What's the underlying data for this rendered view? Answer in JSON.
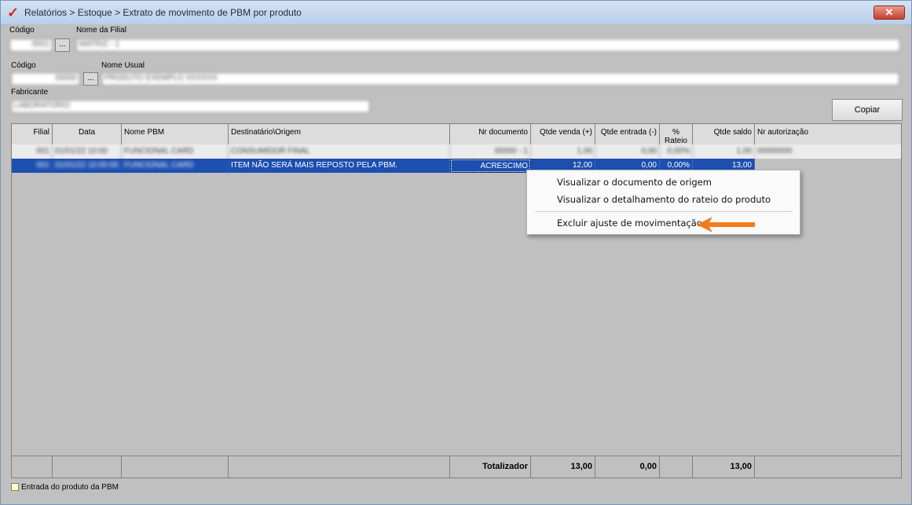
{
  "window": {
    "title": "Relatórios > Estoque > Extrato de movimento de PBM por produto",
    "close_glyph": "✕",
    "icon": "check-logo-icon"
  },
  "filial": {
    "codigo_label": "Código",
    "codigo_value": "0001",
    "nome_label": "Nome da Filial",
    "nome_value": "MATRIZ - 1"
  },
  "produto": {
    "codigo_label": "Código",
    "codigo_value": "00000",
    "nome_label": "Nome Usual",
    "nome_value": "PRODUTO EXEMPLO XXXXXX"
  },
  "fabricante": {
    "label": "Fabricante",
    "value": "LABORATORIO"
  },
  "ellipsis": "...",
  "buttons": {
    "copiar": "Copiar"
  },
  "grid": {
    "columns": [
      "Filial",
      "Data",
      "Nome PBM",
      "Destinatário\\Origem",
      "Nr documento",
      "Qtde venda (+)",
      "Qtde entrada (-)",
      "% Rateio",
      "Qtde saldo",
      "Nr autorização"
    ],
    "rows": [
      {
        "filial": "001",
        "data": "01/01/22 10:00",
        "nome_pbm": "FUNCIONAL CARD",
        "destinatario": "CONSUMIDOR FINAL",
        "nr_documento": "00000 - 1",
        "qtde_venda": "1,00",
        "qtde_entrada": "0,00",
        "rateio": "0,00%",
        "qtde_saldo": "1,00",
        "nr_autorizacao": "00000000"
      },
      {
        "filial": "001",
        "data": "01/01/22 10:00:00",
        "nome_pbm": "FUNCIONAL CARD",
        "destinatario": "ITEM NÃO SERÁ MAIS REPOSTO PELA PBM.",
        "nr_documento": "ACRESCIMO",
        "qtde_venda": "12,00",
        "qtde_entrada": "0,00",
        "rateio": "0,00%",
        "qtde_saldo": "13,00",
        "nr_autorizacao": ""
      }
    ]
  },
  "totals": {
    "label": "Totalizador",
    "qtde_venda": "13,00",
    "qtde_entrada": "0,00",
    "qtde_saldo": "13,00"
  },
  "legend": {
    "entrada_pbm": "Entrada do produto da PBM"
  },
  "context_menu": {
    "items": [
      "Visualizar o documento de origem",
      "Visualizar o detalhamento do rateio do produto",
      "Excluir ajuste de movimentação"
    ]
  },
  "colors": {
    "selection": "#1c4fb0",
    "arrow": "#f07c1e",
    "legend_box": "#ffffc0"
  }
}
